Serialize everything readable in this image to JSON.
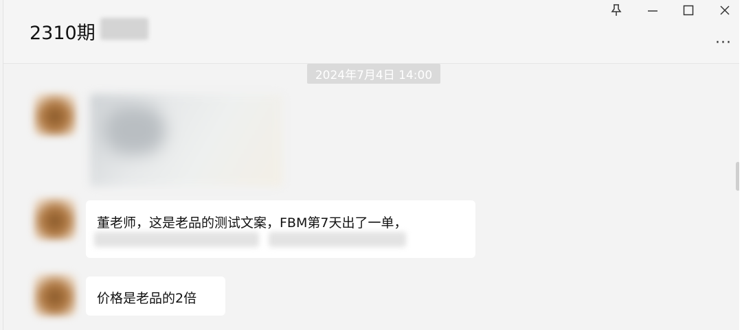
{
  "window": {
    "title": "2310期",
    "controls": {
      "pin_icon": "pin-icon",
      "minimize_icon": "minimize-icon",
      "maximize_icon": "maximize-icon",
      "close_icon": "close-icon"
    },
    "more_label": "···"
  },
  "chat": {
    "timestamp": "2024年7月4日 14:00",
    "messages": [
      {
        "type": "image"
      },
      {
        "type": "text",
        "text": "董老师，这是老品的测试文案，FBM第7天出了一单，"
      },
      {
        "type": "text",
        "text": "价格是老品的2倍"
      }
    ]
  }
}
